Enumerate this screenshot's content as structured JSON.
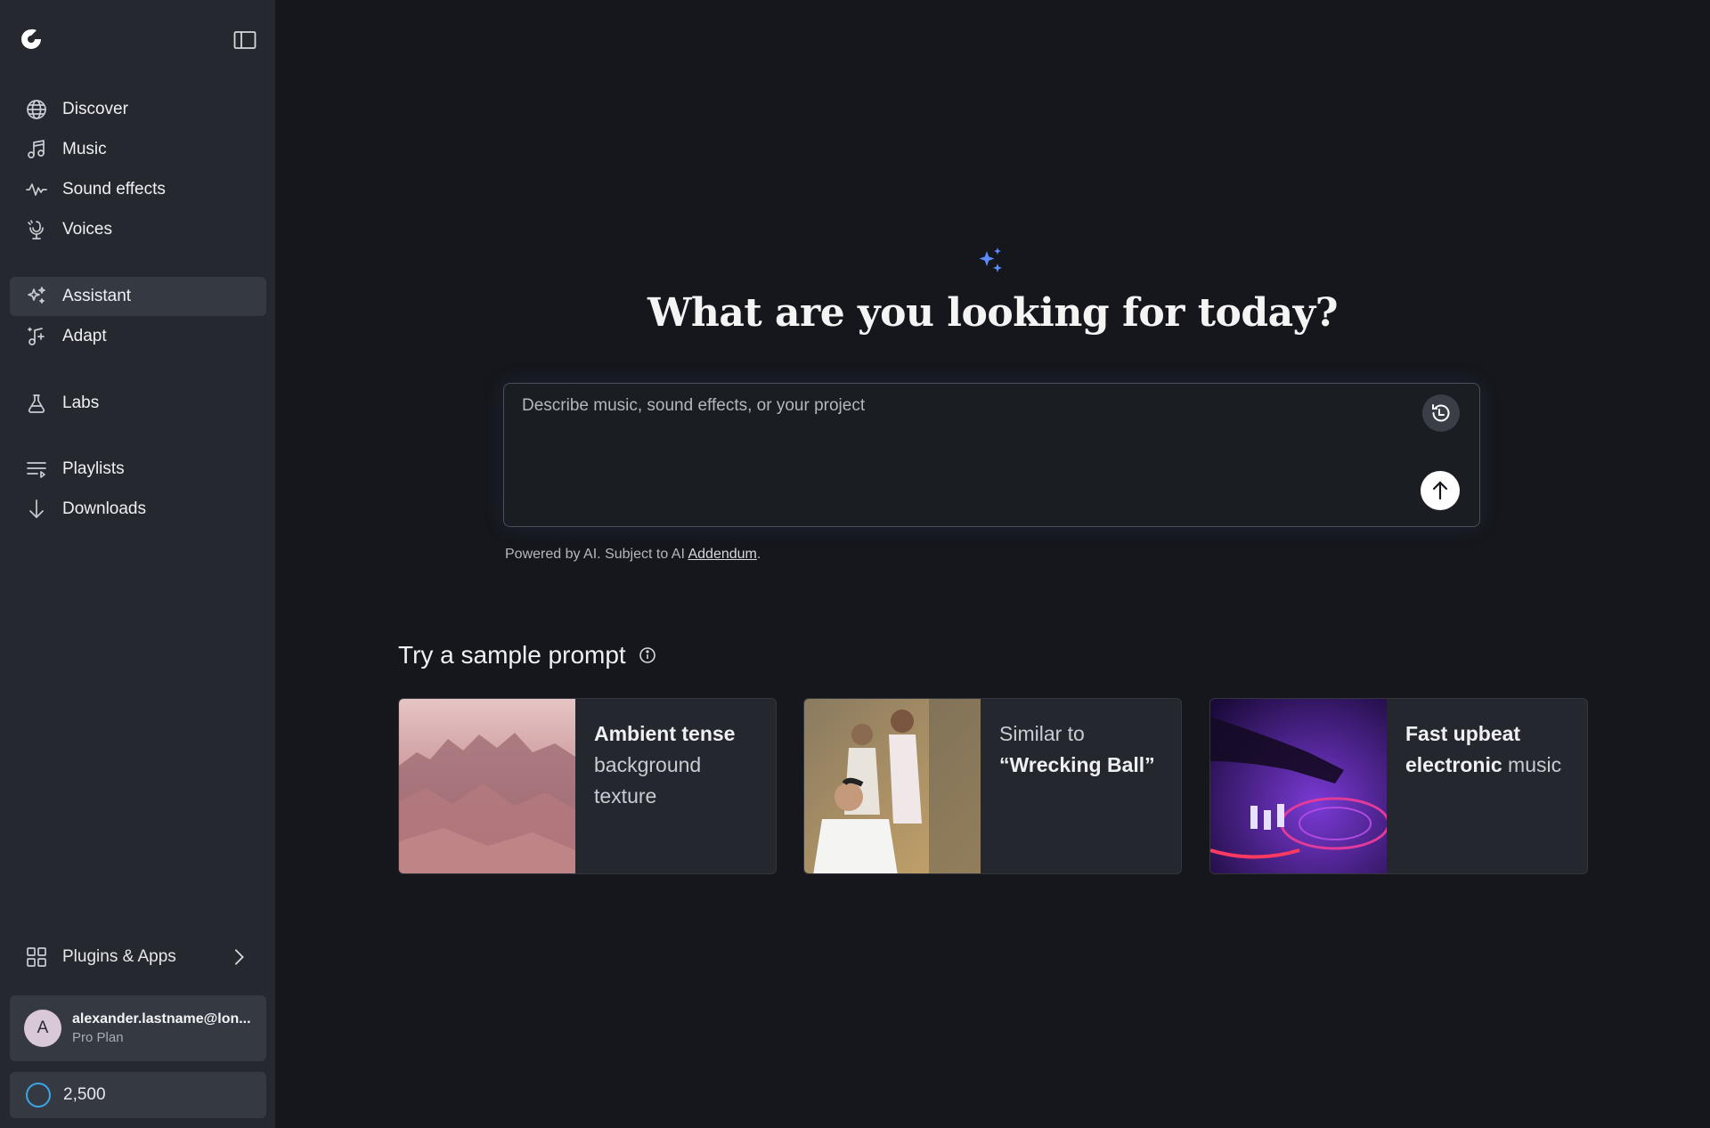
{
  "sidebar": {
    "nav_primary": [
      {
        "label": "Discover",
        "icon": "globe-icon"
      },
      {
        "label": "Music",
        "icon": "music-note-icon"
      },
      {
        "label": "Sound effects",
        "icon": "waveform-icon"
      },
      {
        "label": "Voices",
        "icon": "microphone-icon"
      }
    ],
    "nav_secondary": [
      {
        "label": "Assistant",
        "icon": "sparkle-icon",
        "active": true
      },
      {
        "label": "Adapt",
        "icon": "adapt-icon"
      }
    ],
    "nav_labs": [
      {
        "label": "Labs",
        "icon": "flask-icon"
      }
    ],
    "nav_library": [
      {
        "label": "Playlists",
        "icon": "playlist-icon"
      },
      {
        "label": "Downloads",
        "icon": "download-icon"
      }
    ],
    "plugins_label": "Plugins & Apps",
    "account": {
      "avatar_letter": "A",
      "email": "alexander.lastname@lon...",
      "plan": "Pro Plan"
    },
    "credits": "2,500"
  },
  "main": {
    "headline": "What are you looking for today?",
    "prompt_placeholder": "Describe music, sound effects, or your project",
    "disclaimer_prefix": "Powered by AI. Subject to AI ",
    "disclaimer_link": "Addendum",
    "disclaimer_suffix": ".",
    "sample_title": "Try a sample prompt",
    "samples": [
      {
        "bold": "Ambient tense",
        "rest": " background texture"
      },
      {
        "prefix": "Similar to ",
        "bold": "“Wrecking Ball”"
      },
      {
        "bold": "Fast upbeat electronic",
        "rest": " music"
      }
    ]
  },
  "colors": {
    "sidebar_bg": "#25282e",
    "main_bg": "#15171c",
    "active_item": "#353942",
    "accent_sparkle": "#5b8cff",
    "credits_ring": "#3aa6e6"
  }
}
